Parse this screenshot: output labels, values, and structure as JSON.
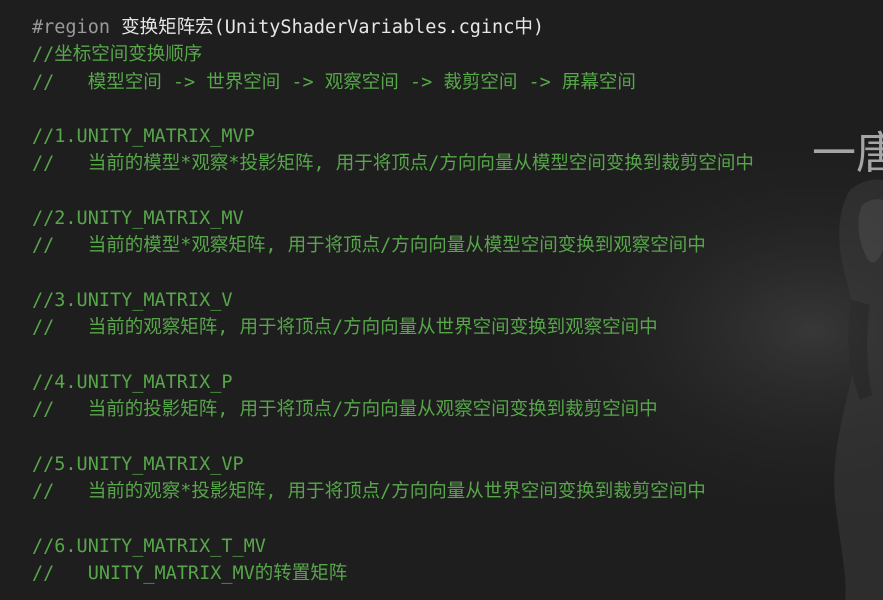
{
  "colors": {
    "background": "#1e1e1e",
    "comment": "#57a64a",
    "region_keyword": "#9a9a9a",
    "region_text": "#e6e6e6"
  },
  "editor": {
    "region_line": {
      "keyword": "#region",
      "text": "变换矩阵宏(UnityShaderVariables.cginc中)"
    },
    "lines": [
      "//坐标空间变换顺序",
      "//   模型空间 -> 世界空间 -> 观察空间 -> 裁剪空间 -> 屏幕空间",
      "",
      "//1.UNITY_MATRIX_MVP",
      "//   当前的模型*观察*投影矩阵, 用于将顶点/方向向量从模型空间变换到裁剪空间中",
      "",
      "//2.UNITY_MATRIX_MV",
      "//   当前的模型*观察矩阵, 用于将顶点/方向向量从模型空间变换到观察空间中",
      "",
      "//3.UNITY_MATRIX_V",
      "//   当前的观察矩阵, 用于将顶点/方向向量从世界空间变换到观察空间中",
      "",
      "//4.UNITY_MATRIX_P",
      "//   当前的投影矩阵, 用于将顶点/方向向量从观察空间变换到裁剪空间中",
      "",
      "//5.UNITY_MATRIX_VP",
      "//   当前的观察*投影矩阵, 用于将顶点/方向向量从世界空间变换到裁剪空间中",
      "",
      "//6.UNITY_MATRIX_T_MV",
      "//   UNITY_MATRIX_MV的转置矩阵"
    ]
  },
  "background_art": {
    "watermark_char": "一唐"
  }
}
